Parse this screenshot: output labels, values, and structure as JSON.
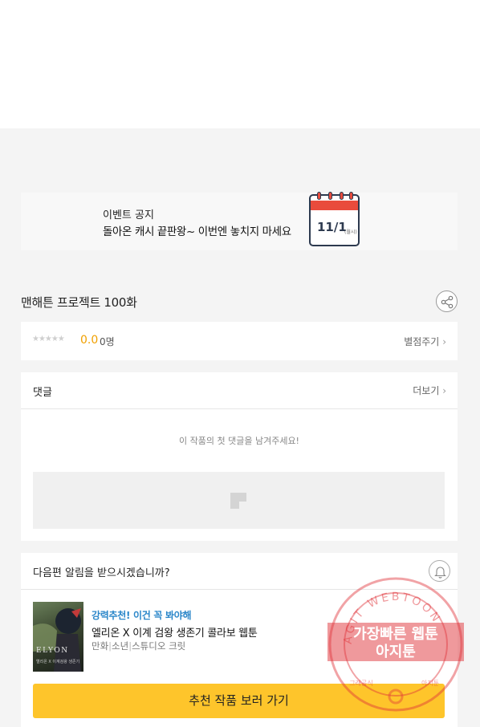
{
  "event": {
    "label": "이벤트 공지",
    "text": "돌아온 캐시 끝판왕~ 이번엔 놓치지 마세요",
    "calendar_date": "11/1",
    "calendar_small": "(월시)"
  },
  "work": {
    "title": "맨해튼 프로젝트 100화"
  },
  "rating": {
    "stars": "★★★★★",
    "score": "0.0",
    "count": "0명",
    "rate_link": "별점주기"
  },
  "comments": {
    "title": "댓글",
    "more_label": "더보기",
    "empty_message": "이 작품의 첫 댓글을 남겨주세요!"
  },
  "notify": {
    "question": "다음편 알림을 받으시겠습니까?",
    "recommend_tag": "강력추천! 이건 꼭 봐야해",
    "recommend_title": "엘리온 X 이계 검왕 생존기 콜라보 웹툰",
    "genre": [
      "만화",
      "소년",
      "스튜디오 크릿"
    ],
    "thumb_title": "ELYON",
    "thumb_sub": "엘리온 X 이계검왕 생존기",
    "cta_label": "추천 작품 보러 가기"
  },
  "stamp": {
    "ring_text": "AGIT WEBTOON",
    "line1": "가장빠른 웹툰",
    "line2": "아지툰",
    "small_left": "그래공식",
    "small_right": "아지툰"
  },
  "colors": {
    "accent_yellow": "#fec52b",
    "score_orange": "#f0a000",
    "tag_blue": "#2a86c9",
    "calendar_red": "#e94b3c",
    "stamp_red": "#e0333a"
  },
  "icons": {
    "share": "share-icon",
    "bell": "bell-icon",
    "chevron": "chevron-right-icon"
  }
}
